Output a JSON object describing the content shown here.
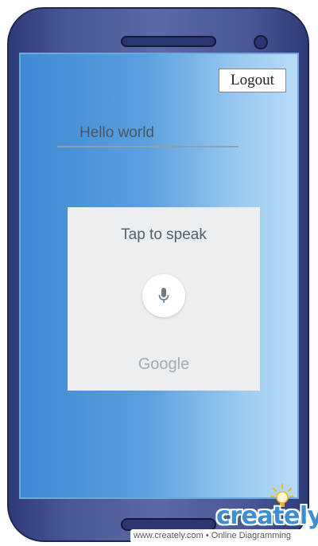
{
  "header": {
    "logout_label": "Logout"
  },
  "main": {
    "text_field_value": "Hello world"
  },
  "voice_dialog": {
    "title": "Tap to speak",
    "mic_icon": "microphone-icon",
    "brand": "Google"
  },
  "watermark": {
    "logo_text": "creately",
    "tagline": "www.creately.com • Online Diagramming"
  },
  "colors": {
    "phone_body": "#4a5796",
    "screen_gradient_start": "#3f8ad4",
    "screen_gradient_end": "#b7dcf7",
    "panel": "#eceff1",
    "brand_blue": "#3d8fd0"
  }
}
